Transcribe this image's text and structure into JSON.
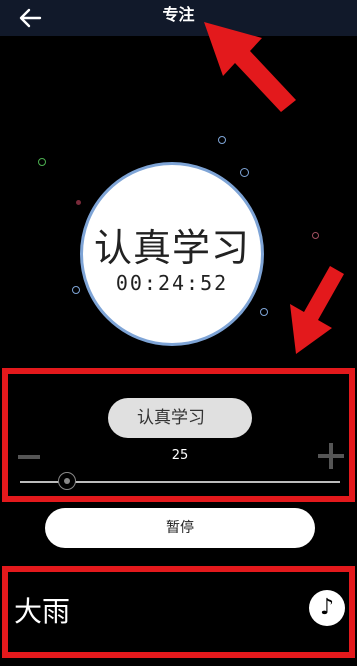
{
  "header": {
    "title": "专注",
    "back_icon": "arrow-left-icon"
  },
  "timer": {
    "task_name": "认真学习",
    "countdown": "00:24:52",
    "ring_color": "#7ea4d6"
  },
  "settings": {
    "task_chip_label": "认真学习",
    "duration_value": "25",
    "slider_fraction": 0.15
  },
  "controls": {
    "pause_label": "暂停"
  },
  "sound": {
    "label": "大雨",
    "icon": "music-note-icon"
  },
  "colors": {
    "accent_red": "#e3191c",
    "topbar": "#11192a"
  }
}
